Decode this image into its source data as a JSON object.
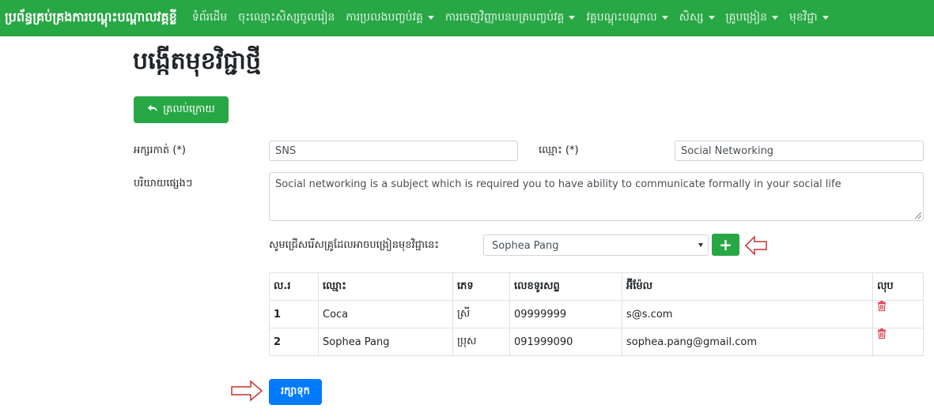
{
  "navbar": {
    "brand": "ប្រព័ន្ធគ្រប់គ្រងការបណ្តុះបណ្តាលវគ្គខ្លី",
    "items": [
      {
        "label": "ទំព័រដើម",
        "dropdown": false
      },
      {
        "label": "ចុះឈ្មោះសិស្សចូលរៀន",
        "dropdown": false
      },
      {
        "label": "ការប្រលងបញ្ចប់វគ្គ",
        "dropdown": true
      },
      {
        "label": "ការចេញវិញ្ញាបនបត្របញ្ចប់វគ្គ",
        "dropdown": true
      },
      {
        "label": "វគ្គបណ្តុះបណ្តាល",
        "dropdown": true
      },
      {
        "label": "សិស្ស",
        "dropdown": true
      },
      {
        "label": "គ្រូបង្រៀន",
        "dropdown": true
      },
      {
        "label": "មុខវិជ្ជា",
        "dropdown": true
      }
    ]
  },
  "page": {
    "title": "បង្កើតមុខវិជ្ជាថ្មី",
    "back_label": "ត្រលប់ក្រោយ"
  },
  "form": {
    "code_label": "អក្សរកាត់ (*)",
    "code_value": "SNS",
    "name_label": "ឈ្មោះ (*)",
    "name_value": "Social Networking",
    "desc_label": "បរិយាយផ្សេងៗ",
    "desc_value": "Social networking is a subject which is required you to have ability to communicate formally in your social life",
    "teacher_prompt": "សូមជ្រើសរើសគ្រូដែលអាចបង្រៀនមុខវិជ្ជានេះ",
    "teacher_selected": "Sophea Pang",
    "add_label": "+"
  },
  "table": {
    "headers": [
      "ល.រ",
      "ឈ្មោះ",
      "ភេទ",
      "លេខទូរសព្ទ",
      "អ៊ីម៉ែល",
      "លុប"
    ],
    "rows": [
      {
        "no": "1",
        "name": "Coca",
        "sex": "ស្រី",
        "phone": "09999999",
        "email": "s@s.com"
      },
      {
        "no": "2",
        "name": "Sophea Pang",
        "sex": "ប្រុស",
        "phone": "091999090",
        "email": "sophea.pang@gmail.com"
      }
    ]
  },
  "save_label": "រក្សាទុក",
  "colors": {
    "navbar": "#28a745",
    "primary": "#007bff",
    "danger": "#dc3545",
    "arrow": "#c9302c"
  }
}
